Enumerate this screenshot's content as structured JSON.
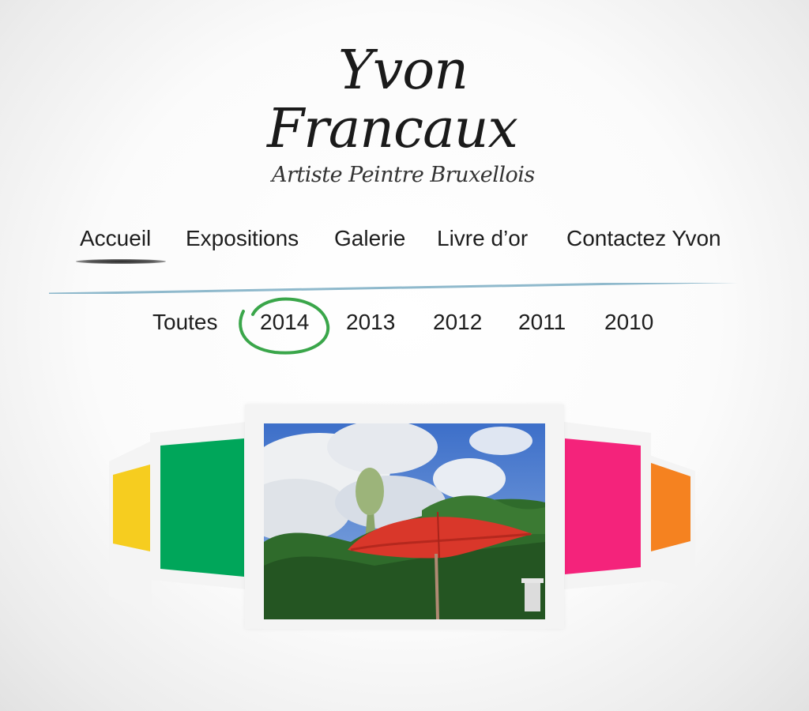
{
  "site": {
    "title_line1": "Yvon",
    "title_line2": "Francaux",
    "subtitle": "Artiste Peintre Bruxellois"
  },
  "nav": {
    "items": [
      {
        "label": "Accueil",
        "active": true
      },
      {
        "label": "Expositions"
      },
      {
        "label": "Galerie"
      },
      {
        "label": "Livre d’or"
      },
      {
        "label": "Contactez Yvon"
      }
    ]
  },
  "years": {
    "items": [
      "Toutes",
      "2014",
      "2013",
      "2012",
      "2011",
      "2010"
    ],
    "selected": "2014"
  },
  "carousel": {
    "colors": {
      "yellow": "#f6cd1f",
      "green": "#00a65a",
      "pink": "#f4237b",
      "orange": "#f58220",
      "divider": "#8fb9cc",
      "circle": "#3aa64a"
    }
  }
}
